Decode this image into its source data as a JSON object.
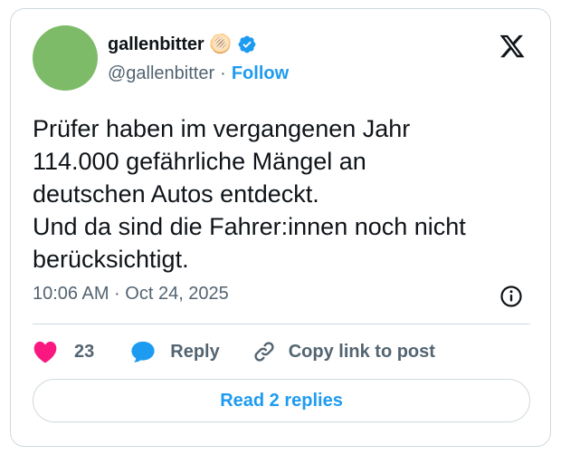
{
  "author": {
    "display_name": "gallenbitter 🫓",
    "handle": "@gallenbitter",
    "separator": "·",
    "follow_label": "Follow"
  },
  "tweet": {
    "text": "Prüfer haben im vergangenen Jahr\n114.000 gefährliche Mängel an\ndeutschen Autos entdeckt.\nUnd da sind die Fahrer:innen noch nicht\nberücksichtigt.",
    "timestamp": "10:06 AM · Oct 24, 2025"
  },
  "actions": {
    "like_count": "23",
    "reply_label": "Reply",
    "copy_label": "Copy link to post"
  },
  "footer": {
    "read_replies_label": "Read 2 replies"
  },
  "colors": {
    "accent": "#1d9bf0",
    "like": "#f91880",
    "secondary_text": "#536471",
    "border": "#cfd9de",
    "avatar": "#7dbb69"
  },
  "icons": {
    "verified": "verified-badge-icon",
    "platform": "x-logo-icon",
    "info": "info-icon",
    "like": "heart-icon",
    "reply": "speech-bubble-icon",
    "copy": "link-icon"
  }
}
